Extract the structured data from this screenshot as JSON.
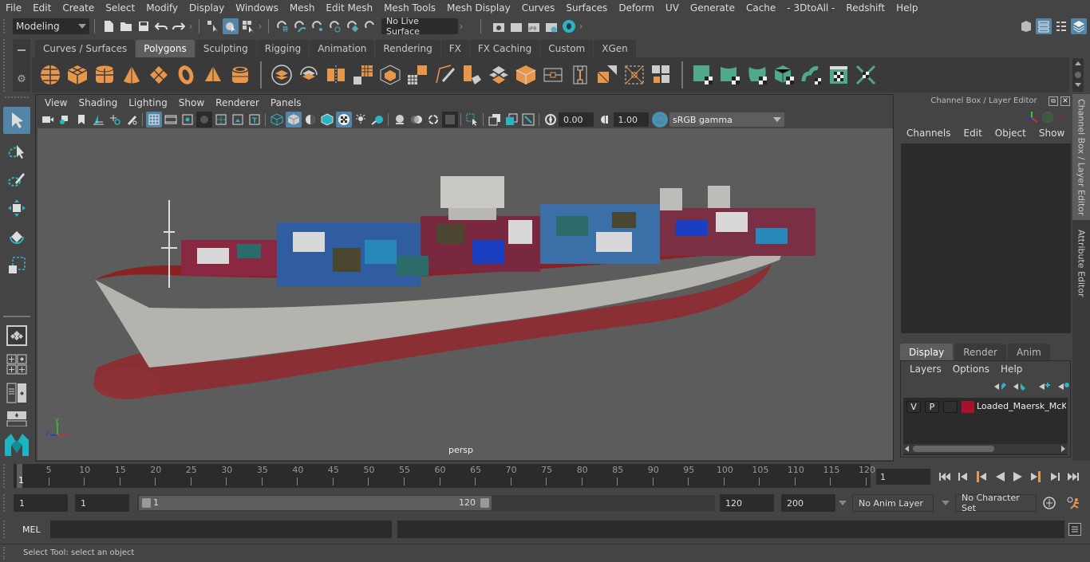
{
  "menubar": {
    "items": [
      "File",
      "Edit",
      "Create",
      "Select",
      "Modify",
      "Display",
      "Windows",
      "Mesh",
      "Edit Mesh",
      "Mesh Tools",
      "Mesh Display",
      "Curves",
      "Surfaces",
      "Deform",
      "UV",
      "Generate",
      "Cache",
      "- 3DtoAll -",
      "Redshift",
      "Help"
    ]
  },
  "statusline": {
    "mode": "Modeling",
    "live_surface": "No Live Surface"
  },
  "shelf": {
    "tabs": [
      "Curves / Surfaces",
      "Polygons",
      "Sculpting",
      "Rigging",
      "Animation",
      "Rendering",
      "FX",
      "FX Caching",
      "Custom",
      "XGen"
    ],
    "active_tab": "Polygons",
    "icons_primitives": [
      "poly-sphere-icon",
      "poly-cube-icon",
      "poly-cylinder-icon",
      "poly-cone-icon",
      "poly-plane-icon",
      "poly-torus-icon",
      "poly-pyramid-icon",
      "poly-pipe-icon"
    ],
    "icons_modeling": [
      "combine-icon",
      "separate-icon",
      "mirror-icon",
      "smooth-icon",
      "extrude-icon",
      "bevel-icon",
      "bridge-icon",
      "multicut-icon",
      "insert-edge-loop-icon",
      "target-weld-icon",
      "quad-draw-icon",
      "edge-flow-icon",
      "collapse-icon",
      "fill-hole-icon",
      "reduce-icon"
    ],
    "icons_uv": [
      "planar-uv-icon",
      "cylindrical-uv-icon",
      "spherical-uv-icon",
      "automatic-uv-icon",
      "unfold-uv-icon",
      "uv-editor-icon",
      "layout-uv-icon"
    ]
  },
  "panel": {
    "menu": [
      "View",
      "Shading",
      "Lighting",
      "Show",
      "Renderer",
      "Panels"
    ],
    "exposure": "0.00",
    "gamma": "1.00",
    "color_mgmt": "ON",
    "color_space": "sRGB gamma",
    "camera_label": "persp"
  },
  "viewport": {
    "axis": {
      "x": "x",
      "y": "y",
      "z": "z"
    }
  },
  "channel_box": {
    "title": "Channel Box / Layer Editor",
    "menu": [
      "Channels",
      "Edit",
      "Object",
      "Show"
    ]
  },
  "layer_editor": {
    "tabs": [
      "Display",
      "Render",
      "Anim"
    ],
    "active_tab": "Display",
    "menu": [
      "Layers",
      "Options",
      "Help"
    ],
    "layers": [
      {
        "visible": "V",
        "playback": "P",
        "type": "",
        "color": "#a8112e",
        "name": "Loaded_Maersk_McKinney"
      }
    ]
  },
  "side_tabs": [
    "Channel Box / Layer Editor",
    "Attribute Editor"
  ],
  "timeline": {
    "start": 1,
    "end": 120,
    "labels": [
      5,
      10,
      15,
      20,
      25,
      30,
      35,
      40,
      45,
      50,
      55,
      60,
      65,
      70,
      75,
      80,
      85,
      90,
      95,
      100,
      105,
      110,
      115,
      120
    ],
    "current_marker": "1",
    "current_frame": "1"
  },
  "range": {
    "start_field": "1",
    "anim_start_field": "1",
    "slider_start": "1",
    "slider_end": "120",
    "end_field": "120",
    "anim_end_field": "200",
    "anim_layer": "No Anim Layer",
    "character_set": "No Character Set"
  },
  "cmdline": {
    "label": "MEL",
    "value": "",
    "result": ""
  },
  "helpline": {
    "text": "Select Tool: select an object"
  },
  "colors": {
    "accent": "#5285a6",
    "shelf_orange": "#e8964a",
    "shelf_green": "#4fa98a",
    "maya_teal": "#1fb5c0"
  }
}
